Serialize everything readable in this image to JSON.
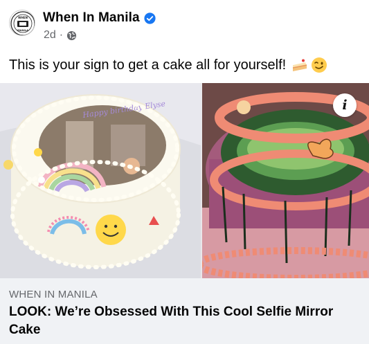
{
  "post": {
    "page_name": "When In Manila",
    "time": "2d",
    "separator": "·",
    "caption": "This is your sign to get a cake all for yourself!",
    "avatar_text": "WHEN IN MANILA",
    "icons": [
      "verified-badge-icon",
      "globe-icon",
      "cake-emoji",
      "winking-face-emoji",
      "info-icon"
    ],
    "colors": {
      "verified": "#1877f2",
      "secondary_text": "#65676b",
      "preview_bg": "#f0f2f5"
    }
  },
  "media": {
    "images": [
      {
        "description_name": "selfie-mirror-cake-left"
      },
      {
        "description_name": "selfie-mirror-cake-right"
      }
    ],
    "cake_writing": "Happy birthday Elyse",
    "info_label": "i"
  },
  "link_preview": {
    "domain": "WHEN IN MANILA",
    "headline": "LOOK: We’re Obsessed With This Cool Selfie Mirror Cake"
  }
}
